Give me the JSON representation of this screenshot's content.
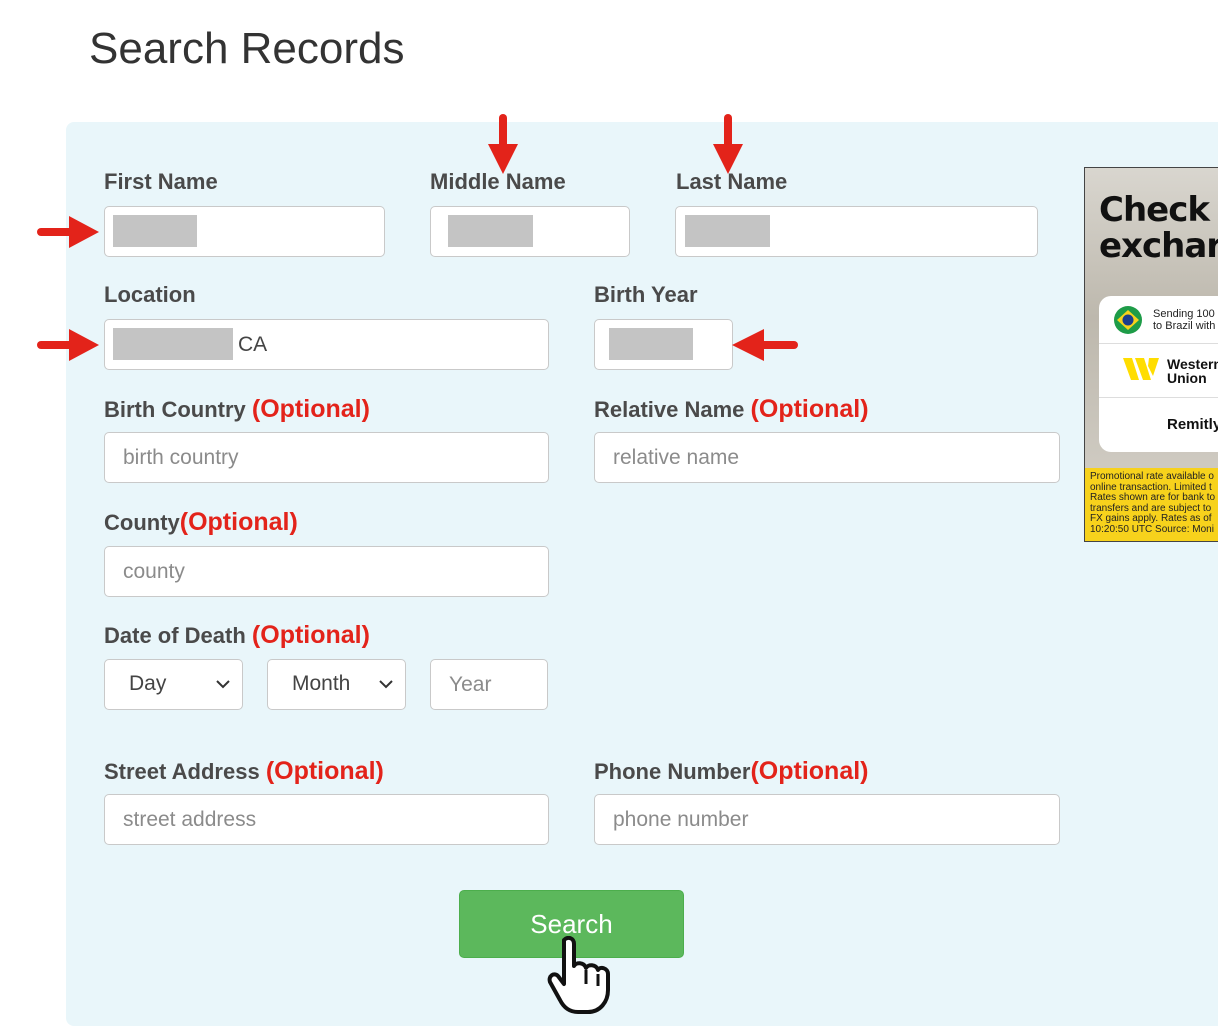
{
  "page": {
    "title": "Search Records"
  },
  "form": {
    "first_name": {
      "label": "First Name"
    },
    "middle_name": {
      "label": "Middle Name"
    },
    "last_name": {
      "label": "Last Name"
    },
    "location": {
      "label": "Location",
      "value_suffix": "CA"
    },
    "birth_year": {
      "label": "Birth Year"
    },
    "birth_country": {
      "label": "Birth Country",
      "optional": "(Optional)",
      "placeholder": "birth country"
    },
    "relative_name": {
      "label": "Relative Name",
      "optional": "(Optional)",
      "placeholder": "relative name"
    },
    "county": {
      "label": "County",
      "optional": "(Optional)",
      "placeholder": "county"
    },
    "date_of_death": {
      "label": "Date of Death",
      "optional": "(Optional)",
      "day": "Day",
      "month": "Month",
      "year_placeholder": "Year"
    },
    "street_address": {
      "label": "Street Address",
      "optional": "(Optional)",
      "placeholder": "street address"
    },
    "phone_number": {
      "label": "Phone Number",
      "optional": "(Optional)",
      "placeholder": "phone number"
    },
    "search_button": "Search"
  },
  "ad": {
    "headline_line1": "Check",
    "headline_line2": "exchar",
    "sending_line1": "Sending 100",
    "sending_line2": "to Brazil with",
    "provider1_line1": "Western",
    "provider1_line2": "Union",
    "provider2": "Remitly",
    "disclaimer": "Promotional rate available o\nonline transaction. Limited t\nRates shown are for bank to\ntransfers and are subject to\nFX gains apply. Rates as of\n10:20:50 UTC Source: Moni",
    "colors": {
      "disclaimer_bg": "#f7d21c",
      "wu_yellow": "#ffdd00"
    }
  },
  "colors": {
    "panel_bg": "#e9f6fa",
    "optional_text": "#e3231a",
    "search_button_bg": "#5cb85c",
    "annotation_arrow": "#e3231a"
  }
}
